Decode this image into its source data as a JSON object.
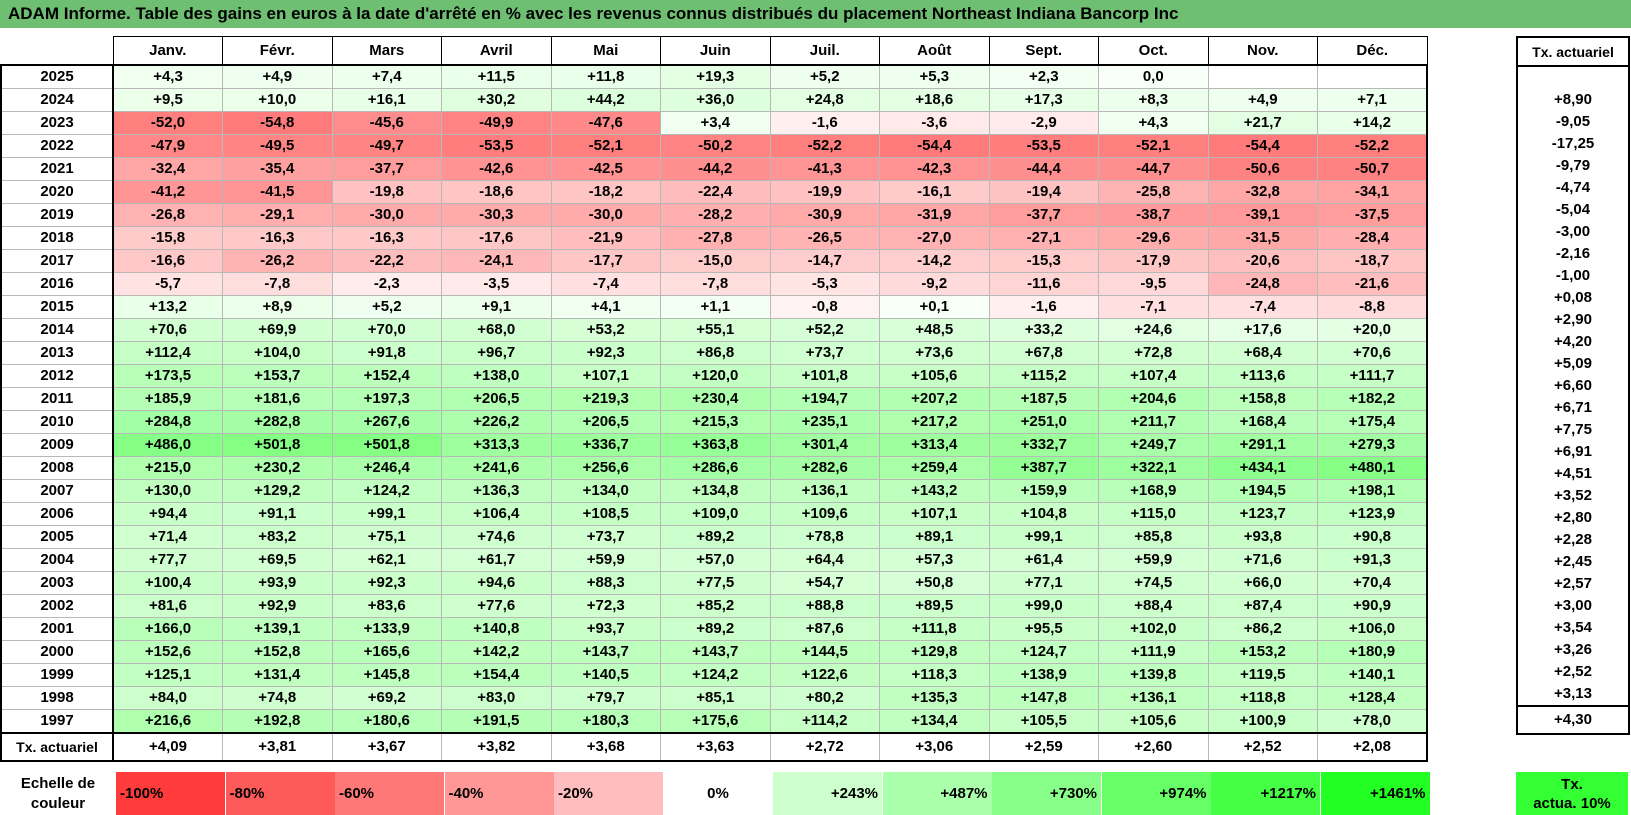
{
  "title": "ADAM Informe. Table des gains en euros à la date d'arrêté en % avec les revenus connus distribués du placement Northeast Indiana Bancorp Inc",
  "months": [
    "Janv.",
    "Févr.",
    "Mars",
    "Avril",
    "Mai",
    "Juin",
    "Juil.",
    "Août",
    "Sept.",
    "Oct.",
    "Nov.",
    "Déc."
  ],
  "actuarial_header": "Tx. actuariel",
  "rows": [
    {
      "year": "2025",
      "values": [
        "+4,3",
        "+4,9",
        "+7,4",
        "+11,5",
        "+11,8",
        "+19,3",
        "+5,2",
        "+5,3",
        "+2,3",
        "0,0",
        "",
        ""
      ],
      "actuarial": ""
    },
    {
      "year": "2024",
      "values": [
        "+9,5",
        "+10,0",
        "+16,1",
        "+30,2",
        "+44,2",
        "+36,0",
        "+24,8",
        "+18,6",
        "+17,3",
        "+8,3",
        "+4,9",
        "+7,1"
      ],
      "actuarial": "+8,90"
    },
    {
      "year": "2023",
      "values": [
        "-52,0",
        "-54,8",
        "-45,6",
        "-49,9",
        "-47,6",
        "+3,4",
        "-1,6",
        "-3,6",
        "-2,9",
        "+4,3",
        "+21,7",
        "+14,2"
      ],
      "actuarial": "-9,05"
    },
    {
      "year": "2022",
      "values": [
        "-47,9",
        "-49,5",
        "-49,7",
        "-53,5",
        "-52,1",
        "-50,2",
        "-52,2",
        "-54,4",
        "-53,5",
        "-52,1",
        "-54,4",
        "-52,2"
      ],
      "actuarial": "-17,25"
    },
    {
      "year": "2021",
      "values": [
        "-32,4",
        "-35,4",
        "-37,7",
        "-42,6",
        "-42,5",
        "-44,2",
        "-41,3",
        "-42,3",
        "-44,4",
        "-44,7",
        "-50,6",
        "-50,7"
      ],
      "actuarial": "-9,79"
    },
    {
      "year": "2020",
      "values": [
        "-41,2",
        "-41,5",
        "-19,8",
        "-18,6",
        "-18,2",
        "-22,4",
        "-19,9",
        "-16,1",
        "-19,4",
        "-25,8",
        "-32,8",
        "-34,1"
      ],
      "actuarial": "-4,74"
    },
    {
      "year": "2019",
      "values": [
        "-26,8",
        "-29,1",
        "-30,0",
        "-30,3",
        "-30,0",
        "-28,2",
        "-30,9",
        "-31,9",
        "-37,7",
        "-38,7",
        "-39,1",
        "-37,5"
      ],
      "actuarial": "-5,04"
    },
    {
      "year": "2018",
      "values": [
        "-15,8",
        "-16,3",
        "-16,3",
        "-17,6",
        "-21,9",
        "-27,8",
        "-26,5",
        "-27,0",
        "-27,1",
        "-29,6",
        "-31,5",
        "-28,4"
      ],
      "actuarial": "-3,00"
    },
    {
      "year": "2017",
      "values": [
        "-16,6",
        "-26,2",
        "-22,2",
        "-24,1",
        "-17,7",
        "-15,0",
        "-14,7",
        "-14,2",
        "-15,3",
        "-17,9",
        "-20,6",
        "-18,7"
      ],
      "actuarial": "-2,16"
    },
    {
      "year": "2016",
      "values": [
        "-5,7",
        "-7,8",
        "-2,3",
        "-3,5",
        "-7,4",
        "-7,8",
        "-5,3",
        "-9,2",
        "-11,6",
        "-9,5",
        "-24,8",
        "-21,6"
      ],
      "actuarial": "-1,00"
    },
    {
      "year": "2015",
      "values": [
        "+13,2",
        "+8,9",
        "+5,2",
        "+9,1",
        "+4,1",
        "+1,1",
        "-0,8",
        "+0,1",
        "-1,6",
        "-7,1",
        "-7,4",
        "-8,8"
      ],
      "actuarial": "+0,08"
    },
    {
      "year": "2014",
      "values": [
        "+70,6",
        "+69,9",
        "+70,0",
        "+68,0",
        "+53,2",
        "+55,1",
        "+52,2",
        "+48,5",
        "+33,2",
        "+24,6",
        "+17,6",
        "+20,0"
      ],
      "actuarial": "+2,90"
    },
    {
      "year": "2013",
      "values": [
        "+112,4",
        "+104,0",
        "+91,8",
        "+96,7",
        "+92,3",
        "+86,8",
        "+73,7",
        "+73,6",
        "+67,8",
        "+72,8",
        "+68,4",
        "+70,6"
      ],
      "actuarial": "+4,20"
    },
    {
      "year": "2012",
      "values": [
        "+173,5",
        "+153,7",
        "+152,4",
        "+138,0",
        "+107,1",
        "+120,0",
        "+101,8",
        "+105,6",
        "+115,2",
        "+107,4",
        "+113,6",
        "+111,7"
      ],
      "actuarial": "+5,09"
    },
    {
      "year": "2011",
      "values": [
        "+185,9",
        "+181,6",
        "+197,3",
        "+206,5",
        "+219,3",
        "+230,4",
        "+194,7",
        "+207,2",
        "+187,5",
        "+204,6",
        "+158,8",
        "+182,2"
      ],
      "actuarial": "+6,60"
    },
    {
      "year": "2010",
      "values": [
        "+284,8",
        "+282,8",
        "+267,6",
        "+226,2",
        "+206,5",
        "+215,3",
        "+235,1",
        "+217,2",
        "+251,0",
        "+211,7",
        "+168,4",
        "+175,4"
      ],
      "actuarial": "+6,71"
    },
    {
      "year": "2009",
      "values": [
        "+486,0",
        "+501,8",
        "+501,8",
        "+313,3",
        "+336,7",
        "+363,8",
        "+301,4",
        "+313,4",
        "+332,7",
        "+249,7",
        "+291,1",
        "+279,3"
      ],
      "actuarial": "+7,75"
    },
    {
      "year": "2008",
      "values": [
        "+215,0",
        "+230,2",
        "+246,4",
        "+241,6",
        "+256,6",
        "+286,6",
        "+282,6",
        "+259,4",
        "+387,7",
        "+322,1",
        "+434,1",
        "+480,1"
      ],
      "actuarial": "+6,91"
    },
    {
      "year": "2007",
      "values": [
        "+130,0",
        "+129,2",
        "+124,2",
        "+136,3",
        "+134,0",
        "+134,8",
        "+136,1",
        "+143,2",
        "+159,9",
        "+168,9",
        "+194,5",
        "+198,1"
      ],
      "actuarial": "+4,51"
    },
    {
      "year": "2006",
      "values": [
        "+94,4",
        "+91,1",
        "+99,1",
        "+106,4",
        "+108,5",
        "+109,0",
        "+109,6",
        "+107,1",
        "+104,8",
        "+115,0",
        "+123,7",
        "+123,9"
      ],
      "actuarial": "+3,52"
    },
    {
      "year": "2005",
      "values": [
        "+71,4",
        "+83,2",
        "+75,1",
        "+74,6",
        "+73,7",
        "+89,2",
        "+78,8",
        "+89,1",
        "+99,1",
        "+85,8",
        "+93,8",
        "+90,8"
      ],
      "actuarial": "+2,80"
    },
    {
      "year": "2004",
      "values": [
        "+77,7",
        "+69,5",
        "+62,1",
        "+61,7",
        "+59,9",
        "+57,0",
        "+64,4",
        "+57,3",
        "+61,4",
        "+59,9",
        "+71,6",
        "+91,3"
      ],
      "actuarial": "+2,28"
    },
    {
      "year": "2003",
      "values": [
        "+100,4",
        "+93,9",
        "+92,3",
        "+94,6",
        "+88,3",
        "+77,5",
        "+54,7",
        "+50,8",
        "+77,1",
        "+74,5",
        "+66,0",
        "+70,4"
      ],
      "actuarial": "+2,45"
    },
    {
      "year": "2002",
      "values": [
        "+81,6",
        "+92,9",
        "+83,6",
        "+77,6",
        "+72,3",
        "+85,2",
        "+88,8",
        "+89,5",
        "+99,0",
        "+88,4",
        "+87,4",
        "+90,9"
      ],
      "actuarial": "+2,57"
    },
    {
      "year": "2001",
      "values": [
        "+166,0",
        "+139,1",
        "+133,9",
        "+140,8",
        "+93,7",
        "+89,2",
        "+87,6",
        "+111,8",
        "+95,5",
        "+102,0",
        "+86,2",
        "+106,0"
      ],
      "actuarial": "+3,00"
    },
    {
      "year": "2000",
      "values": [
        "+152,6",
        "+152,8",
        "+165,6",
        "+142,2",
        "+143,7",
        "+143,7",
        "+144,5",
        "+129,8",
        "+124,7",
        "+111,9",
        "+153,2",
        "+180,9"
      ],
      "actuarial": "+3,54"
    },
    {
      "year": "1999",
      "values": [
        "+125,1",
        "+131,4",
        "+145,8",
        "+154,4",
        "+140,5",
        "+124,2",
        "+122,6",
        "+118,3",
        "+138,9",
        "+139,8",
        "+119,5",
        "+140,1"
      ],
      "actuarial": "+3,26"
    },
    {
      "year": "1998",
      "values": [
        "+84,0",
        "+74,8",
        "+69,2",
        "+83,0",
        "+79,7",
        "+85,1",
        "+80,2",
        "+135,3",
        "+147,8",
        "+136,1",
        "+118,8",
        "+128,4"
      ],
      "actuarial": "+2,52"
    },
    {
      "year": "1997",
      "values": [
        "+216,6",
        "+192,8",
        "+180,6",
        "+191,5",
        "+180,3",
        "+175,6",
        "+114,2",
        "+134,4",
        "+105,5",
        "+105,6",
        "+100,9",
        "+78,0"
      ],
      "actuarial": "+3,13"
    }
  ],
  "totals": {
    "label": "Tx. actuariel",
    "values": [
      "+4,09",
      "+3,81",
      "+3,67",
      "+3,82",
      "+3,68",
      "+3,63",
      "+2,72",
      "+3,06",
      "+2,59",
      "+2,60",
      "+2,52",
      "+2,08"
    ],
    "actuarial": "+4,30"
  },
  "scale": {
    "label_line1": "Echelle de",
    "label_line2": "couleur",
    "swatches": [
      {
        "label": "-100%",
        "color": "#ff3b3b",
        "kind": "neg"
      },
      {
        "label": "-80%",
        "color": "#ff5a5a",
        "kind": "neg"
      },
      {
        "label": "-60%",
        "color": "#ff7878",
        "kind": "neg"
      },
      {
        "label": "-40%",
        "color": "#ff9797",
        "kind": "neg"
      },
      {
        "label": "-20%",
        "color": "#ffbdbd",
        "kind": "neg"
      },
      {
        "label": "0%",
        "color": "#ffffff",
        "kind": "zero"
      },
      {
        "label": "+243%",
        "color": "#ccffcc",
        "kind": "pos"
      },
      {
        "label": "+487%",
        "color": "#aaffaa",
        "kind": "pos"
      },
      {
        "label": "+730%",
        "color": "#88ff88",
        "kind": "pos"
      },
      {
        "label": "+974%",
        "color": "#66ff66",
        "kind": "pos"
      },
      {
        "label": "+1217%",
        "color": "#44ff44",
        "kind": "pos"
      },
      {
        "label": "+1461%",
        "color": "#22ff22",
        "kind": "pos"
      }
    ],
    "actua_line1": "Tx.",
    "actua_line2": "actua. 10%",
    "actua_color": "#33ff33"
  },
  "colors": {
    "title_bg": "#6fbf73",
    "negative_max": "#ff3b3b",
    "positive_max": "#44ff44"
  }
}
